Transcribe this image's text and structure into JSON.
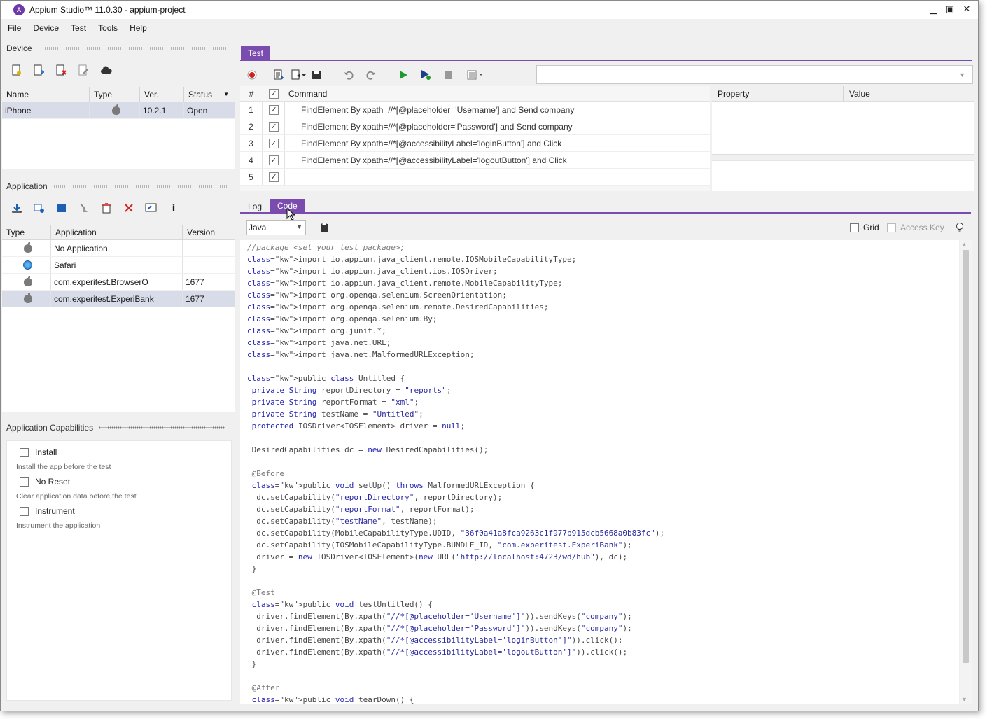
{
  "window": {
    "title": "Appium Studio™ 11.0.30 - appium-project",
    "logo_letter": "A",
    "controls": [
      "minimize",
      "maximize",
      "close"
    ]
  },
  "menu": [
    "File",
    "Device",
    "Test",
    "Tools",
    "Help"
  ],
  "device_section": {
    "title": "Device",
    "toolbar_icons": [
      "add-device-icon",
      "add-device-plus-icon",
      "remove-device-icon",
      "edit-device-icon",
      "cloud-icon"
    ],
    "columns": [
      "Name",
      "Type",
      "Ver.",
      "Status"
    ],
    "rows": [
      {
        "name": "iPhone",
        "type_icon": "apple-icon",
        "version": "10.2.1",
        "status": "Open"
      }
    ]
  },
  "application_section": {
    "title": "Application",
    "toolbar_icons": [
      "install-icon",
      "add-application-icon",
      "stop-icon",
      "clean-icon",
      "uninstall-icon",
      "delete-icon",
      "launch-icon",
      "info-icon"
    ],
    "columns": [
      "Type",
      "Application",
      "Version"
    ],
    "rows": [
      {
        "type_icon": "apple-icon",
        "name": "No Application",
        "version": ""
      },
      {
        "type_icon": "safari-icon",
        "name": "Safari",
        "version": ""
      },
      {
        "type_icon": "apple-icon",
        "name": "com.experitest.BrowserO",
        "version": "1677"
      },
      {
        "type_icon": "apple-icon",
        "name": "com.experitest.ExperiBank",
        "version": "1677"
      }
    ]
  },
  "capabilities": {
    "title": "Application Capabilities",
    "items": [
      {
        "label": "Install",
        "desc": "Install the app before the test",
        "checked": false
      },
      {
        "label": "No Reset",
        "desc": "Clear application data before the test",
        "checked": false
      },
      {
        "label": "Instrument",
        "desc": "Instrument the application",
        "checked": false
      }
    ]
  },
  "test_tab": {
    "label": "Test"
  },
  "command_table": {
    "num_header": "#",
    "command_header": "Command",
    "rows": [
      {
        "num": "1",
        "text": "FindElement By  xpath=//*[@placeholder='Username']  and Send  company"
      },
      {
        "num": "2",
        "text": "FindElement By  xpath=//*[@placeholder='Password']  and Send  company"
      },
      {
        "num": "3",
        "text": "FindElement By  xpath=//*[@accessibilityLabel='loginButton']  and Click"
      },
      {
        "num": "4",
        "text": "FindElement By  xpath=//*[@accessibilityLabel='logoutButton']  and Click"
      },
      {
        "num": "5",
        "text": ""
      }
    ]
  },
  "property_panel": {
    "property_header": "Property",
    "value_header": "Value"
  },
  "bottom_tabs": {
    "log": "Log",
    "code": "Code"
  },
  "code_toolbar": {
    "language": "Java",
    "grid_label": "Grid",
    "access_key_label": "Access Key"
  },
  "code_lines": [
    "//package <set your test package>;",
    "import io.appium.java_client.remote.IOSMobileCapabilityType;",
    "import io.appium.java_client.ios.IOSDriver;",
    "import io.appium.java_client.remote.MobileCapabilityType;",
    "import org.openqa.selenium.ScreenOrientation;",
    "import org.openqa.selenium.remote.DesiredCapabilities;",
    "import org.openqa.selenium.By;",
    "import org.junit.*;",
    "import java.net.URL;",
    "import java.net.MalformedURLException;",
    "",
    "public class Untitled {",
    " private String reportDirectory = \"reports\";",
    " private String reportFormat = \"xml\";",
    " private String testName = \"Untitled\";",
    " protected IOSDriver<IOSElement> driver = null;",
    "",
    " DesiredCapabilities dc = new DesiredCapabilities();",
    "",
    " @Before",
    " public void setUp() throws MalformedURLException {",
    "  dc.setCapability(\"reportDirectory\", reportDirectory);",
    "  dc.setCapability(\"reportFormat\", reportFormat);",
    "  dc.setCapability(\"testName\", testName);",
    "  dc.setCapability(MobileCapabilityType.UDID, \"36f0a41a8fca9263c1f977b915dcb5668a0b83fc\");",
    "  dc.setCapability(IOSMobileCapabilityType.BUNDLE_ID, \"com.experitest.ExperiBank\");",
    "  driver = new IOSDriver<IOSElement>(new URL(\"http://localhost:4723/wd/hub\"), dc);",
    " }",
    "",
    " @Test",
    " public void testUntitled() {",
    "  driver.findElement(By.xpath(\"//*[@placeholder='Username']\")).sendKeys(\"company\");",
    "  driver.findElement(By.xpath(\"//*[@placeholder='Password']\")).sendKeys(\"company\");",
    "  driver.findElement(By.xpath(\"//*[@accessibilityLabel='loginButton']\")).click();",
    "  driver.findElement(By.xpath(\"//*[@accessibilityLabel='logoutButton']\")).click();",
    " }",
    "",
    " @After",
    " public void tearDown() {"
  ],
  "colors": {
    "accent": "#7a4cb0",
    "selected_row": "#d8dbe8",
    "keyword": "#1f1fb0",
    "record": "#d42020",
    "play": "#1e9a2e"
  }
}
